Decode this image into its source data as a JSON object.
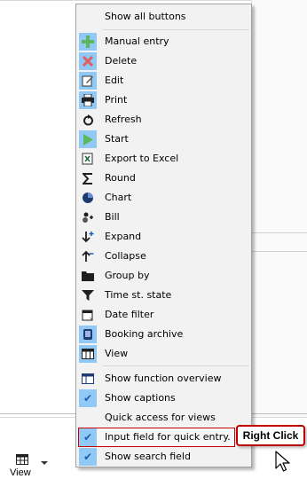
{
  "menu": {
    "show_all": "Show all buttons",
    "buttons": [
      {
        "label": "Manual entry",
        "icon": "plus-icon",
        "color": "#5cb85c"
      },
      {
        "label": "Delete",
        "icon": "cross-icon",
        "color": "#e06060"
      },
      {
        "label": "Edit",
        "icon": "edit-icon",
        "color": "#3a3a3a"
      },
      {
        "label": "Print",
        "icon": "printer-icon",
        "color": "#1f1f1f"
      },
      {
        "label": "Refresh",
        "icon": "refresh-icon",
        "color": "#1f1f1f"
      },
      {
        "label": "Start",
        "icon": "play-icon",
        "color": "#5cb85c"
      },
      {
        "label": "Export to Excel",
        "icon": "excel-icon",
        "color": "#1f6f3a"
      },
      {
        "label": "Round",
        "icon": "sigma-icon",
        "color": "#1f1f1f"
      },
      {
        "label": "Chart",
        "icon": "pie-chart-icon",
        "color": "#1f3a70"
      },
      {
        "label": "Bill",
        "icon": "bill-icon",
        "color": "#1f1f1f"
      },
      {
        "label": "Expand",
        "icon": "expand-icon",
        "color": "#1f1f1f"
      },
      {
        "label": "Collapse",
        "icon": "collapse-icon",
        "color": "#1f1f1f"
      },
      {
        "label": "Group by",
        "icon": "folder-icon",
        "color": "#1f1f1f"
      },
      {
        "label": "Time st. state",
        "icon": "filter-icon",
        "color": "#1f1f1f"
      },
      {
        "label": "Date filter",
        "icon": "calendar-icon",
        "color": "#1f1f1f"
      },
      {
        "label": "Booking archive",
        "icon": "archive-icon",
        "color": "#1f3a70"
      },
      {
        "label": "View",
        "icon": "grid-view-icon",
        "color": "#1f1f1f"
      }
    ],
    "options": [
      {
        "label": "Show function overview",
        "icon": "overview-icon",
        "checked": false
      },
      {
        "label": "Show captions",
        "icon": "check-icon",
        "checked": true
      },
      {
        "label": "Quick access for views",
        "icon": "",
        "checked": false
      },
      {
        "label": "Input field for quick entry.",
        "icon": "check-icon",
        "checked": true,
        "selected": true
      },
      {
        "label": "Show search field",
        "icon": "check-icon",
        "checked": true
      }
    ]
  },
  "toolbar": {
    "view_label": "View"
  },
  "callout": {
    "text": "Right Click"
  },
  "colors": {
    "highlight": "#90c8f6",
    "callout_border": "#c00000",
    "check": "#1a5fb4"
  }
}
